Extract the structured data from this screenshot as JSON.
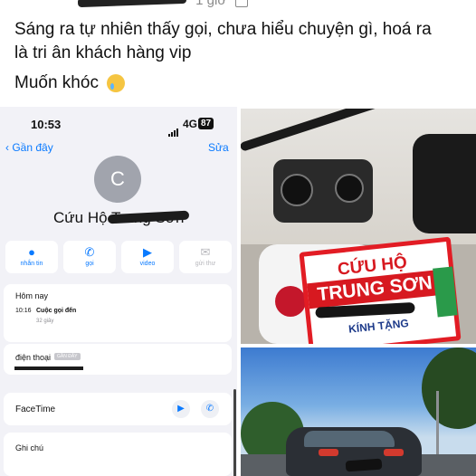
{
  "post": {
    "header_time": "1 giờ",
    "caption_line1": "Sáng ra tự nhiên thấy gọi, chưa hiểu chuyện gì, hoá ra",
    "caption_line2": "là tri ân khách hàng vip",
    "caption_line3": "Muốn khóc",
    "caption_emoji": "crying-face"
  },
  "phone": {
    "status_time": "10:53",
    "network": "4G",
    "battery": "87",
    "back_label": "Gần đây",
    "edit_label": "Sửa",
    "avatar_letter": "C",
    "contact_name_visible": "Cứu Hộ ",
    "contact_name_struck": "Trung Sơn",
    "actions": [
      {
        "label": "nhắn tin",
        "icon": "message-icon",
        "enabled": true
      },
      {
        "label": "gọi",
        "icon": "phone-icon",
        "enabled": true
      },
      {
        "label": "video",
        "icon": "video-icon",
        "enabled": true
      },
      {
        "label": "gửi thư",
        "icon": "mail-icon",
        "enabled": false
      }
    ],
    "recent": {
      "title": "Hôm nay",
      "time": "10:16",
      "type": "Cuộc gọi đến",
      "duration": "32 giây"
    },
    "phone_card": {
      "label": "điện thoại",
      "badge": "GẦN ĐÂY"
    },
    "facetime_label": "FaceTime",
    "notes_label": "Ghi chú"
  },
  "photos": {
    "sign_line1": "CỨU HỘ",
    "sign_line2": "TRUNG SƠN",
    "sign_line3": "KÍNH TẶNG"
  }
}
